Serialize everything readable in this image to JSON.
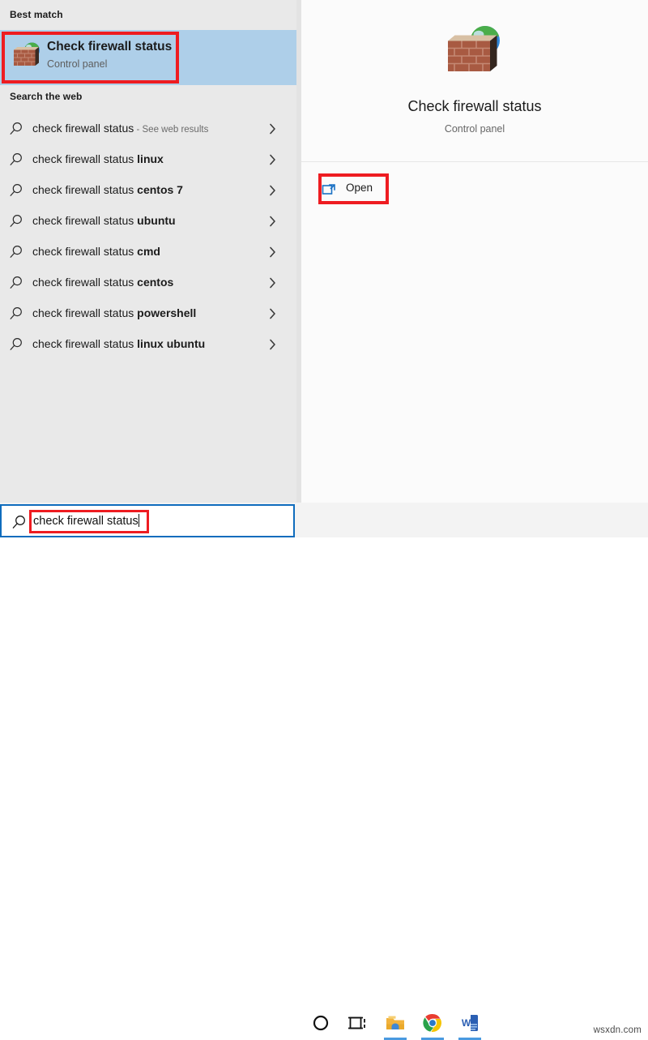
{
  "search_panel": {
    "best_match_header": "Best match",
    "web_header": "Search the web",
    "best_match": {
      "title": "Check firewall status",
      "subtitle": "Control panel",
      "icon": "firewall-icon"
    },
    "web_results": [
      {
        "query": "check firewall status",
        "suffix": "",
        "trailing_note": " - See web results",
        "chevron": "chevron-right-icon"
      },
      {
        "query": "check firewall status ",
        "suffix": "linux",
        "trailing_note": "",
        "chevron": "chevron-right-icon"
      },
      {
        "query": "check firewall status ",
        "suffix": "centos 7",
        "trailing_note": "",
        "chevron": "chevron-right-icon"
      },
      {
        "query": "check firewall status ",
        "suffix": "ubuntu",
        "trailing_note": "",
        "chevron": "chevron-right-icon"
      },
      {
        "query": "check firewall status ",
        "suffix": "cmd",
        "trailing_note": "",
        "chevron": "chevron-right-icon"
      },
      {
        "query": "check firewall status ",
        "suffix": "centos",
        "trailing_note": "",
        "chevron": "chevron-right-icon"
      },
      {
        "query": "check firewall status ",
        "suffix": "powershell",
        "trailing_note": "",
        "chevron": "chevron-right-icon"
      },
      {
        "query": "check firewall status ",
        "suffix": "linux ubuntu",
        "trailing_note": "",
        "chevron": "chevron-right-icon"
      }
    ]
  },
  "preview": {
    "title": "Check firewall status",
    "subtitle": "Control panel",
    "icon": "firewall-icon",
    "open_label": "Open",
    "open_icon": "open-in-new-window-icon"
  },
  "taskbar": {
    "search_value": "check firewall status",
    "search_icon": "search-icon",
    "cortana_icon": "cortana-circle-icon",
    "task_view_icon": "task-view-icon",
    "file_explorer_icon": "file-explorer-icon",
    "chrome_icon": "google-chrome-icon",
    "word_icon": "microsoft-word-icon",
    "watermark": "wsxdn.com"
  },
  "colors": {
    "highlight_red": "#ee1c21",
    "selection_blue": "#aecfe9",
    "search_border_blue": "#0f6cbd",
    "pane_bg": "#e9e9e9",
    "preview_bg": "#fbfbfb",
    "taskbar_bg": "#f3f3f3"
  }
}
